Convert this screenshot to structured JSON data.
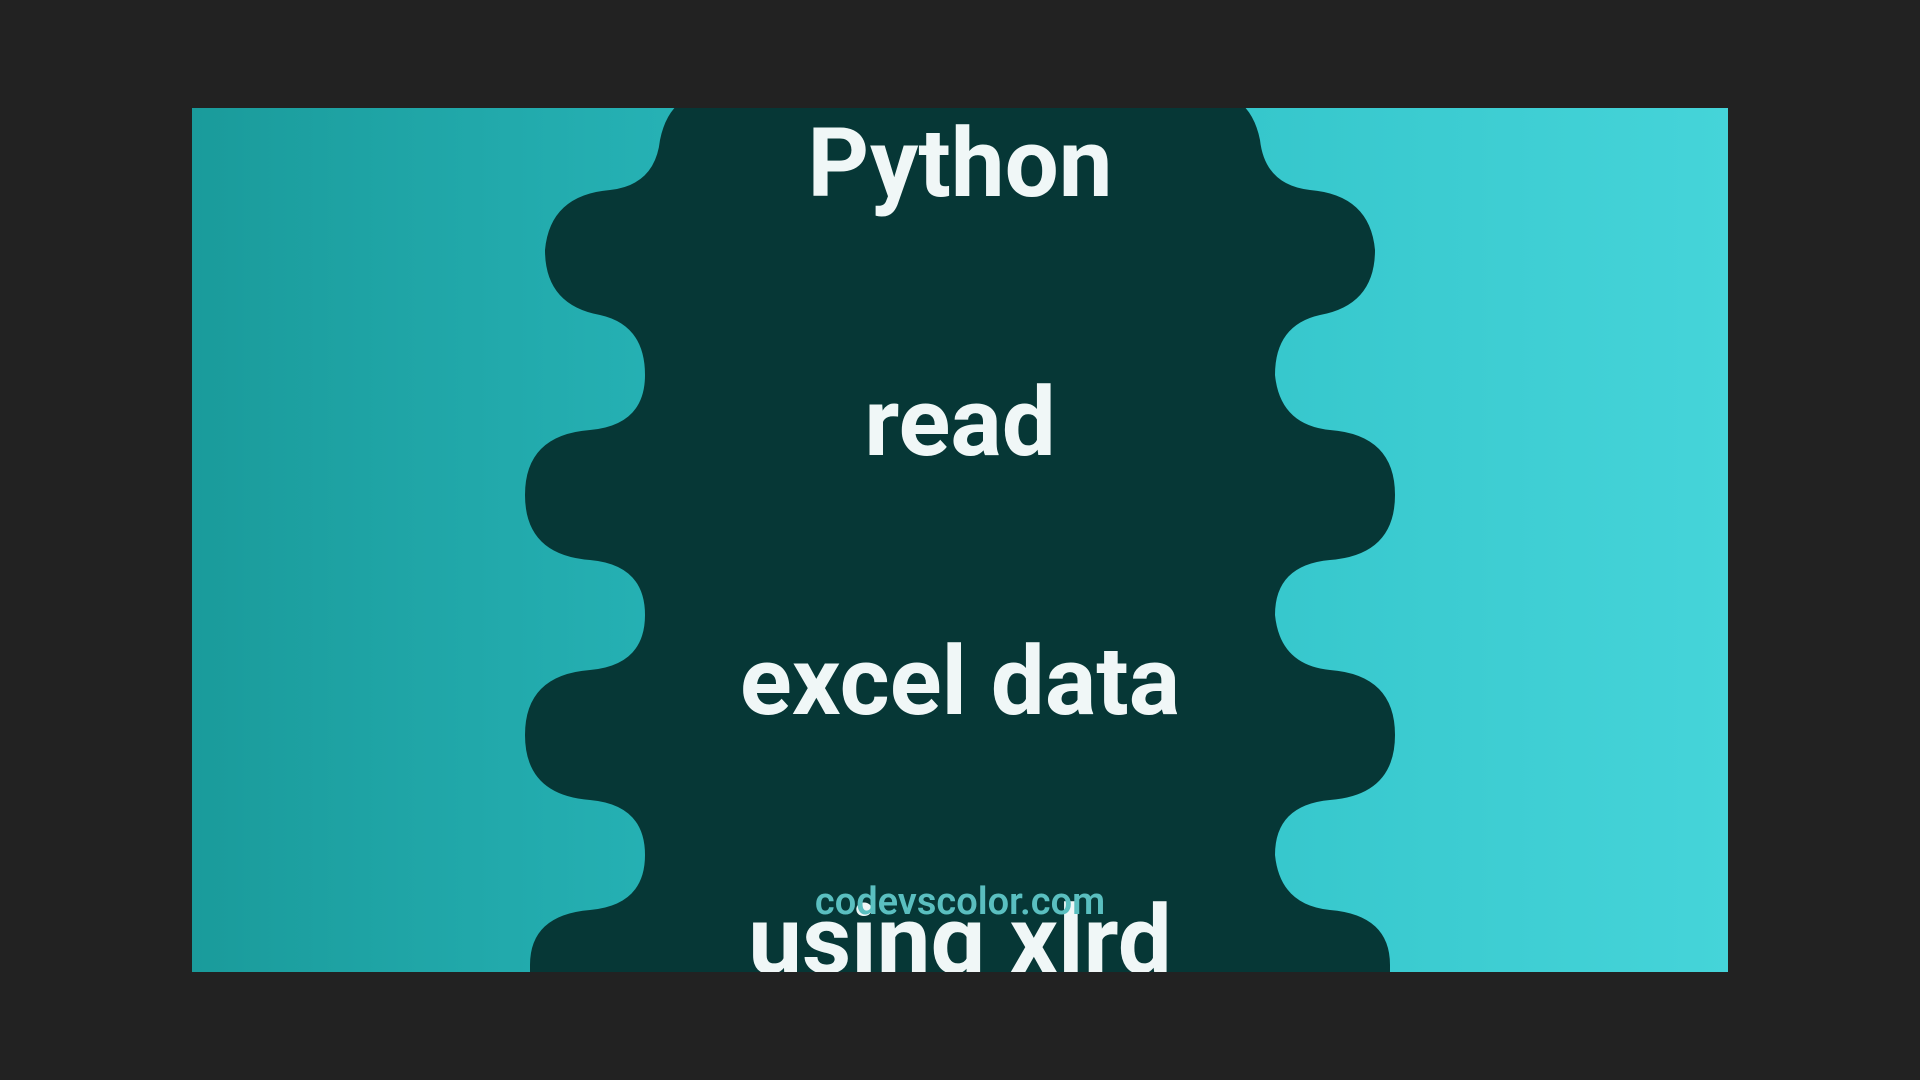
{
  "title": {
    "line1": "Python",
    "line2": "read",
    "line3": "excel data",
    "line4": "using xlrd"
  },
  "credit": "codevscolor.com",
  "colors": {
    "gradient_start": "#1a9b9b",
    "gradient_end": "#45d4d9",
    "blob": "#063736",
    "text": "#f0f7f7",
    "credit": "#5abfc0"
  }
}
